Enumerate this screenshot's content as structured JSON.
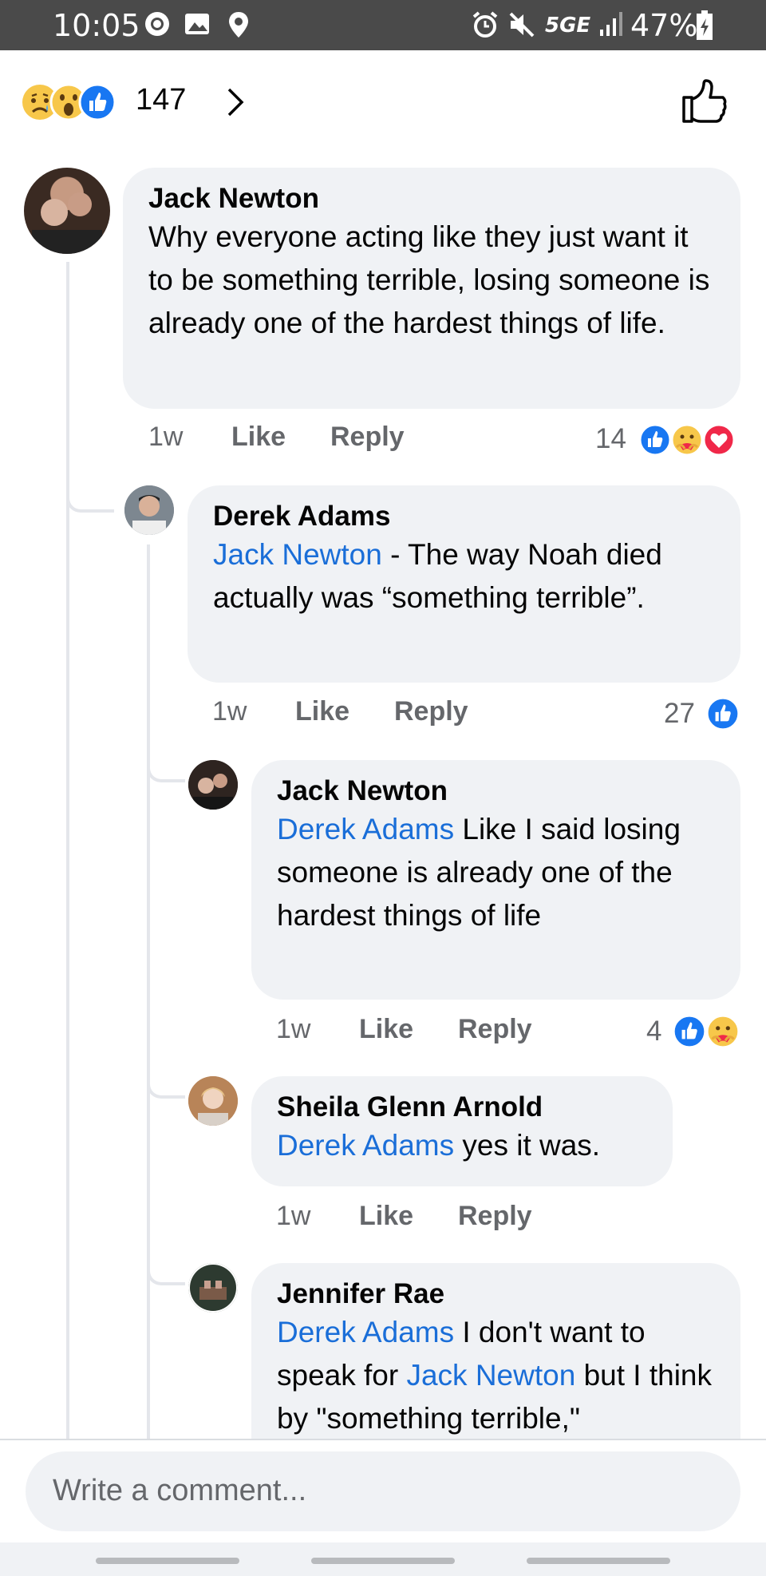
{
  "status_bar": {
    "time": "10:05",
    "network": "5GE",
    "battery": "47%",
    "icons": [
      "whatsapp-icon",
      "gallery-icon",
      "location-icon",
      "alarm-icon",
      "mute-icon",
      "signal-icon",
      "battery-charging-icon"
    ]
  },
  "reaction_summary": {
    "emojis": [
      "sad-reaction-icon",
      "wow-reaction-icon",
      "like-reaction-icon"
    ],
    "count": "147",
    "like_icon": "thumbs-up-outline-icon"
  },
  "comments": [
    {
      "author": "Jack Newton",
      "mention": "",
      "text": "Why everyone acting like they just want it to be something terrible, losing someone is already one of the hardest things of life.",
      "time": "1w",
      "like": "Like",
      "reply": "Reply",
      "reaction_count": "14",
      "reactions": [
        "like-reaction-icon",
        "care-reaction-icon",
        "love-reaction-icon"
      ]
    },
    {
      "author": "Derek Adams",
      "mention": "Jack Newton",
      "text": " - The way Noah died actually was “something terrible”.",
      "time": "1w",
      "like": "Like",
      "reply": "Reply",
      "reaction_count": "27",
      "reactions": [
        "like-reaction-icon"
      ]
    },
    {
      "author": "Jack Newton",
      "mention": "Derek Adams",
      "text": " Like I said losing someone is already one of the hardest things of life",
      "time": "1w",
      "like": "Like",
      "reply": "Reply",
      "reaction_count": "4",
      "reactions": [
        "like-reaction-icon",
        "care-reaction-icon"
      ]
    },
    {
      "author": "Sheila Glenn Arnold",
      "mention": "Derek Adams",
      "text": " yes it was.",
      "time": "1w",
      "like": "Like",
      "reply": "Reply"
    },
    {
      "author": "Jennifer Rae",
      "mention": "Derek Adams",
      "text": " I don't want to speak for ",
      "mention2": "Jack Newton",
      "text2": " but I think by \"something terrible,\""
    }
  ],
  "composer": {
    "placeholder": "Write a comment..."
  },
  "colors": {
    "link": "#1a6ed8",
    "bubble": "#f0f2f5",
    "like_blue": "#1877f2",
    "love_red": "#f02849",
    "status_bar": "#4a4a4a"
  }
}
